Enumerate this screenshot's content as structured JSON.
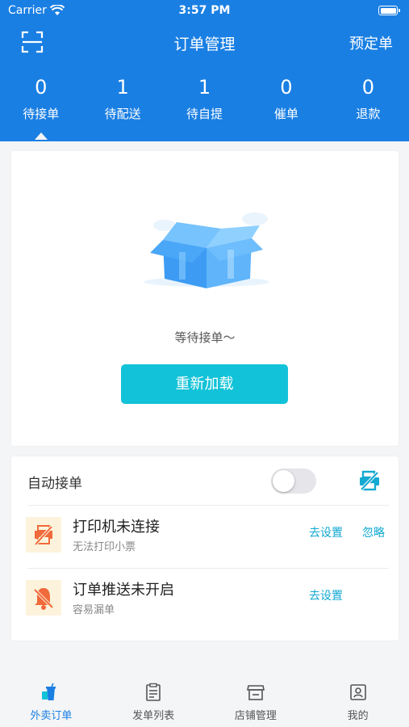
{
  "status_bar": {
    "carrier": "Carrier",
    "time": "3:57 PM"
  },
  "nav": {
    "title": "订单管理",
    "right_action": "预定单",
    "left_icon": "scan-icon"
  },
  "stats": [
    {
      "count": "0",
      "label": "待接单",
      "selected": true
    },
    {
      "count": "1",
      "label": "待配送",
      "selected": false
    },
    {
      "count": "1",
      "label": "待自提",
      "selected": false
    },
    {
      "count": "0",
      "label": "催单",
      "selected": false
    },
    {
      "count": "0",
      "label": "退款",
      "selected": false
    }
  ],
  "empty_state": {
    "icon": "empty-box-illustration",
    "message": "等待接单～",
    "reload_label": "重新加载"
  },
  "auto_accept": {
    "label": "自动接单",
    "enabled": false,
    "printer_icon": "printer-disconnected-icon"
  },
  "alerts": [
    {
      "icon": "printer-off-icon",
      "title": "打印机未连接",
      "subtitle": "无法打印小票",
      "actions": [
        "去设置",
        "忽略"
      ]
    },
    {
      "icon": "bell-off-icon",
      "title": "订单推送未开启",
      "subtitle": "容易漏单",
      "actions": [
        "去设置"
      ]
    }
  ],
  "tabbar": [
    {
      "label": "外卖订单",
      "icon": "takeout-cup-icon",
      "active": true
    },
    {
      "label": "发单列表",
      "icon": "clipboard-list-icon",
      "active": false
    },
    {
      "label": "店铺管理",
      "icon": "store-icon",
      "active": false
    },
    {
      "label": "我的",
      "icon": "profile-card-icon",
      "active": false
    }
  ],
  "colors": {
    "primary": "#1a7fe3",
    "accent": "#12c2d8",
    "link": "#12a9d2",
    "warning_bg": "#fdf3dc",
    "warning": "#f06a3b"
  }
}
